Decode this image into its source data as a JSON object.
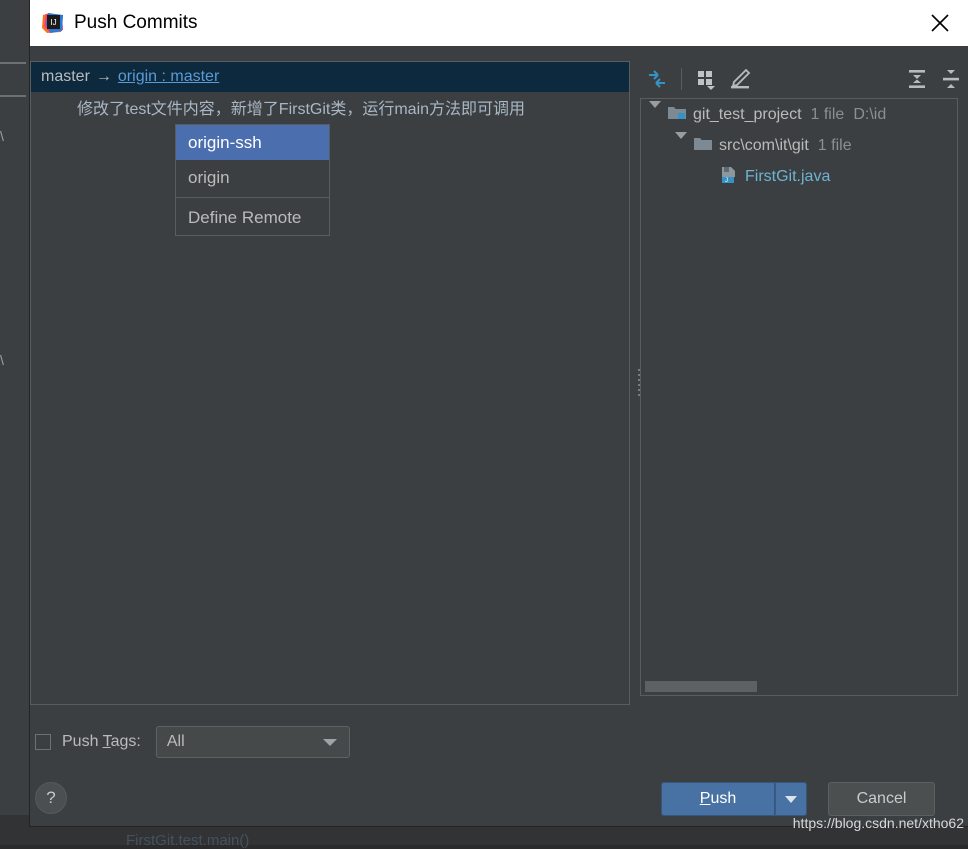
{
  "window": {
    "title": "Push Commits",
    "logo_icon": "intellij-idea-logo",
    "close_icon": "close-icon"
  },
  "commits": {
    "branch_local": "master",
    "branch_arrow": "→",
    "branch_remote": "origin : master",
    "commit_message": "修改了test文件内容，新增了FirstGit类，运行main方法即可调用"
  },
  "remote_popup": {
    "items": [
      {
        "label": "origin-ssh",
        "selected": true
      },
      {
        "label": "origin",
        "selected": false
      },
      {
        "label": "Define Remote",
        "selected": false,
        "separator_before": true
      }
    ]
  },
  "files_toolbar": {
    "buttons": [
      {
        "name": "collapse-to-selection-icon",
        "label": ""
      },
      {
        "name": "group-by-icon",
        "label": ""
      },
      {
        "name": "edit-source-icon",
        "label": ""
      },
      {
        "name": "expand-all-icon",
        "label": ""
      },
      {
        "name": "collapse-all-icon",
        "label": ""
      }
    ]
  },
  "files_tree": {
    "nodes": [
      {
        "label": "git_test_project",
        "count": "1 file",
        "path": "D:\\id",
        "icon": "module-folder-icon",
        "expanded": true,
        "depth": 0,
        "type": "module"
      },
      {
        "label": "src\\com\\it\\git",
        "count": "1 file",
        "path": "",
        "icon": "folder-icon",
        "expanded": true,
        "depth": 1,
        "type": "folder"
      },
      {
        "label": "FirstGit.java",
        "count": "",
        "path": "",
        "icon": "java-file-icon",
        "expanded": false,
        "depth": 2,
        "type": "file"
      }
    ]
  },
  "push_tags": {
    "checkbox_checked": false,
    "label_prefix": "Push ",
    "label_mnemonic": "T",
    "label_suffix": "ags:",
    "combo_value": "All",
    "combo_arrow_icon": "chevron-down-icon"
  },
  "footer": {
    "help_label": "?",
    "push_prefix": "",
    "push_mnemonic": "P",
    "push_suffix": "ush",
    "push_dropdown_icon": "chevron-down-icon",
    "cancel_label": "Cancel"
  },
  "watermark": "https://blog.csdn.net/xtho62",
  "backdrop": {
    "ghost_code": "FirstGit.test.main()",
    "edge_text": "\\"
  },
  "colors": {
    "dialog_bg": "#3c3f41",
    "titlebar_bg": "#ffffff",
    "selection_row": "#0d293e",
    "popup_selected": "#4b6eaf",
    "link": "#5b9bd5",
    "file_text": "#6fb3d2",
    "accent_button": "#4872a3",
    "text": "#bbbbbb",
    "muted_text": "#8c8f91"
  }
}
